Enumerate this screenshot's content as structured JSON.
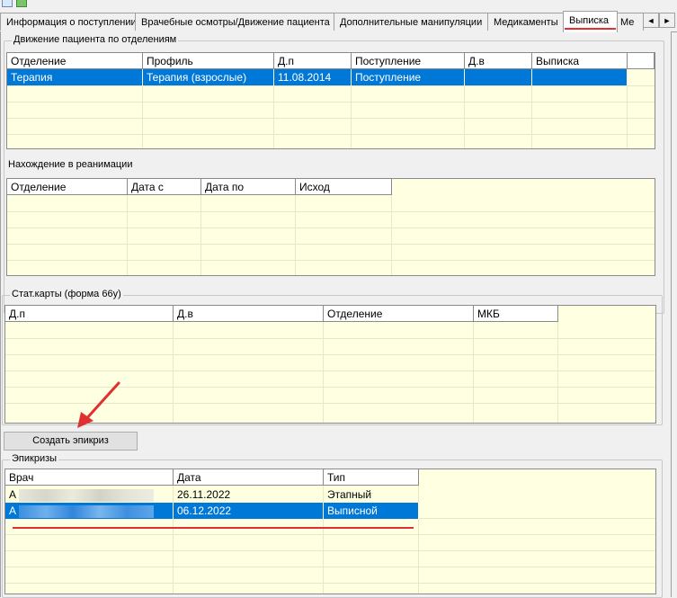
{
  "tabs": [
    {
      "label": "Информация о поступлении"
    },
    {
      "label": "Врачебные осмотры/Движение пациента"
    },
    {
      "label": "Дополнительные манипуляции"
    },
    {
      "label": "Медикаменты"
    },
    {
      "label": "Выписка"
    },
    {
      "label": "Ме"
    }
  ],
  "tab_arrows": {
    "left": "◄",
    "right": "►"
  },
  "movement": {
    "legend": "Движение пациента по отделениям",
    "columns": [
      "Отделение",
      "Профиль",
      "Д.п",
      "Поступление",
      "Д.в",
      "Выписка"
    ],
    "rows": [
      {
        "otdelenie": "Терапия",
        "profil": "Терапия (взрослые)",
        "dp": "11.08.2014",
        "postuplenie": "Поступление",
        "dv": "",
        "vypiska": ""
      }
    ]
  },
  "reanimation": {
    "label": "Нахождение в реанимации",
    "columns": [
      "Отделение",
      "Дата с",
      "Дата по",
      "Исход"
    ]
  },
  "statcards": {
    "legend": "Стат.карты (форма 66у)",
    "columns": [
      "Д.п",
      "Д.в",
      "Отделение",
      "МКБ"
    ]
  },
  "create_button": {
    "label": "Создать эпикриз"
  },
  "epicrises": {
    "legend": "Эпикризы",
    "columns": [
      "Врач",
      "Дата",
      "Тип"
    ],
    "rows": [
      {
        "doctor_initial": "А",
        "date": "26.11.2022",
        "type": "Этапный"
      },
      {
        "doctor_initial": "А",
        "date": "06.12.2022",
        "type": "Выписной"
      }
    ]
  },
  "colors": {
    "accent": "#0078d7",
    "annotation": "#e03030",
    "grid_bg": "#ffffe1"
  }
}
